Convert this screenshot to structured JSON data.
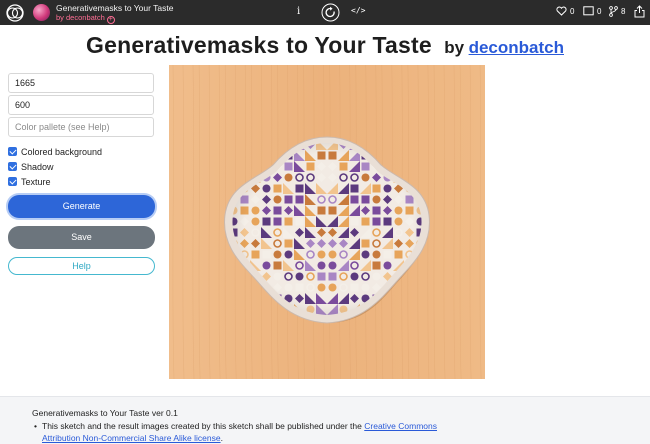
{
  "topbar": {
    "title": "Generativemasks to Your Taste",
    "byline": "by deconbatch",
    "info_symbol": "i",
    "code_symbol": "</>",
    "likes": "0",
    "comments": "0",
    "forks": "8"
  },
  "heading": {
    "title": "Generativemasks to Your Taste",
    "by": "by",
    "author": "deconbatch"
  },
  "controls": {
    "field1_value": "1665",
    "field2_value": "600",
    "palette_placeholder": "Color pallete (see Help)",
    "check_colored": "Colored background",
    "check_shadow": "Shadow",
    "check_texture": "Texture",
    "generate_label": "Generate",
    "save_label": "Save",
    "help_label": "Help"
  },
  "canvas": {
    "background_color": "#eeb784",
    "palette": [
      "#7a4b9c",
      "#a986c4",
      "#e7a45a",
      "#f2c48e",
      "#f4efe8",
      "#c87a3c",
      "#5c3a7e"
    ]
  },
  "footer": {
    "version": "Generativemasks to Your Taste ver 0.1",
    "text_before_link": "This sketch and the result images created by this sketch shall be published under the ",
    "link_text": "Creative Commons Attribution Non-Commercial Share Alike license",
    "text_after_link": "."
  }
}
